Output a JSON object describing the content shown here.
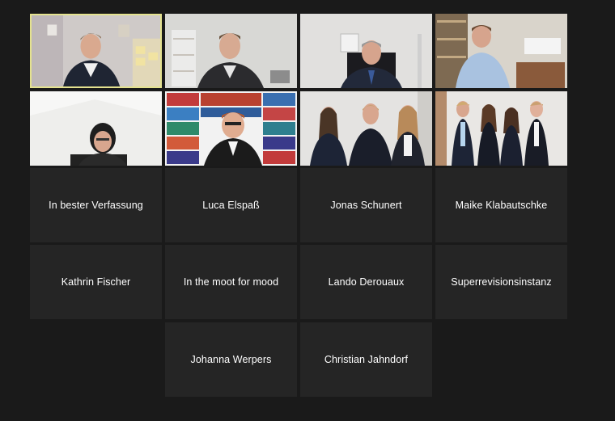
{
  "participants_with_name": [
    "In bester Verfassung",
    "Luca Elspaß",
    "Jonas Schunert",
    "Maike Klabautschke",
    "Kathrin Fischer",
    "In the moot for mood",
    "Lando Derouaux",
    "Superrevisionsinstanz",
    "Johanna Werpers",
    "Christian Jahndorf"
  ],
  "colors": {
    "background": "#1a1a1a",
    "tile": "#252525",
    "active_speaker_border": "#e4e28f"
  }
}
